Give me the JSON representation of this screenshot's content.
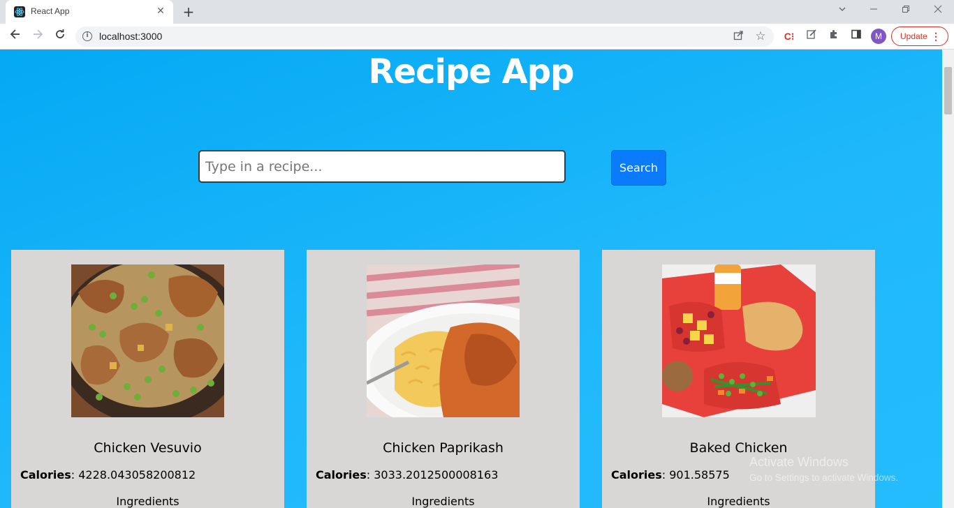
{
  "browser": {
    "tab_title": "React App",
    "tab_close": "✕",
    "new_tab": "+",
    "url": "localhost:3000",
    "update_label": "Update",
    "avatar_letter": "M",
    "ext_c_label": "C⁝"
  },
  "app": {
    "title": "Recipe App",
    "search_placeholder": "Type in a recipe...",
    "search_button": "Search"
  },
  "recipes": [
    {
      "name": "Chicken Vesuvio",
      "calories_label": "Calories",
      "calories": "4228.043058200812",
      "ingredients_label": "Ingredients"
    },
    {
      "name": "Chicken Paprikash",
      "calories_label": "Calories",
      "calories": "3033.2012500008163",
      "ingredients_label": "Ingredients"
    },
    {
      "name": "Baked Chicken",
      "calories_label": "Calories",
      "calories": "901.58575",
      "ingredients_label": "Ingredients"
    }
  ],
  "watermark": {
    "title": "Activate Windows",
    "subtitle": "Go to Settings to activate Windows."
  },
  "colors": {
    "page_bg": "#1fb8fb",
    "search_button": "#0a7bfd",
    "card_bg": "#d9d6d6",
    "update_accent": "#d93025"
  }
}
